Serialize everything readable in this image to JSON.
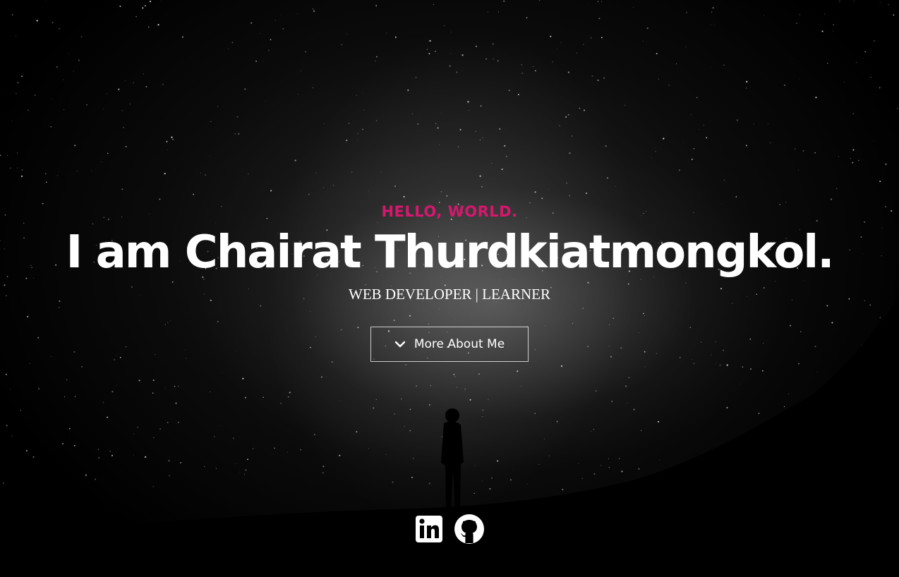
{
  "hero": {
    "greeting": "HELLO, WORLD.",
    "headline": "I am Chairat Thurdkiatmongkol.",
    "tagline": "WEB DEVELOPER | LEARNER",
    "cta_label": "More About Me",
    "cta_icon": "chevron-down-icon"
  },
  "social": [
    {
      "name": "LinkedIn",
      "icon": "linkedin-icon"
    },
    {
      "name": "GitHub",
      "icon": "github-icon"
    }
  ],
  "colors": {
    "accent": "#d6176e",
    "text": "#ffffff",
    "background": "#000000"
  }
}
